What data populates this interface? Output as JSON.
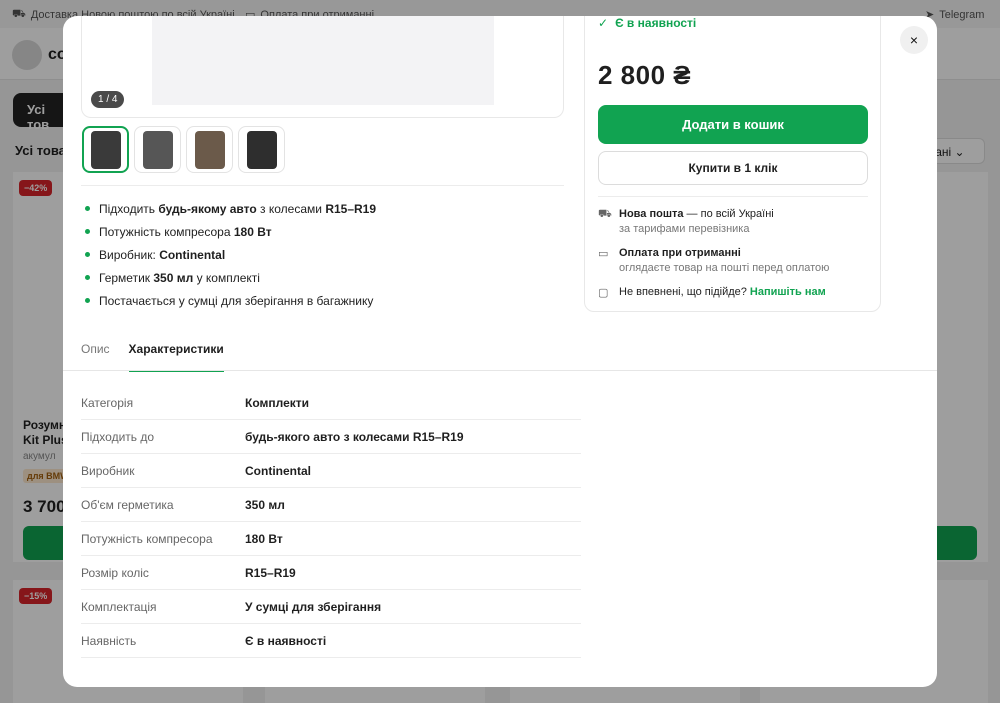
{
  "topbar": {
    "delivery": "Доставка Новою поштою по всій Україні",
    "payment": "Оплата при отриманні",
    "telegram": "Telegram"
  },
  "header": {
    "logo_text": "co"
  },
  "background": {
    "all_button": "Усі тов",
    "section_title": "Усі това",
    "sort": "вані",
    "card1": {
      "discount": "−42%",
      "title_line1": "Розумн",
      "title_line2": "Kit Plus",
      "subtitle": "акумул",
      "tag": "для BMW",
      "price": "3 700"
    },
    "card2": {
      "discount": "−15%"
    }
  },
  "modal": {
    "close_label": "×",
    "gallery": {
      "counter": "1 / 4",
      "thumbnails": [
        "thumb-1",
        "thumb-2",
        "thumb-3",
        "thumb-4"
      ]
    },
    "features": [
      {
        "pre": "Підходить ",
        "bold": "будь-якому авто",
        "mid": " з колесами ",
        "bold2": "R15–R19"
      },
      {
        "pre": "Потужність компресора ",
        "bold": "180 Вт",
        "mid": "",
        "bold2": ""
      },
      {
        "pre": "Виробник: ",
        "bold": "Continental",
        "mid": "",
        "bold2": ""
      },
      {
        "pre": "Герметик ",
        "bold": "350 мл",
        "mid": " у комплекті",
        "bold2": ""
      },
      {
        "pre": "Постачається у сумці для зберігання в багажнику",
        "bold": "",
        "mid": "",
        "bold2": ""
      }
    ],
    "tabs": [
      {
        "label": "Опис",
        "active": false
      },
      {
        "label": "Характеристики",
        "active": true
      }
    ],
    "specs": [
      {
        "key": "Категорія",
        "value": "Комплекти"
      },
      {
        "key": "Підходить до",
        "value": "будь-якого авто з колесами R15–R19"
      },
      {
        "key": "Виробник",
        "value": "Continental"
      },
      {
        "key": "Об'єм герметика",
        "value": "350 мл"
      },
      {
        "key": "Потужність компресора",
        "value": "180 Вт"
      },
      {
        "key": "Розмір коліс",
        "value": "R15–R19"
      },
      {
        "key": "Комплектація",
        "value": "У сумці для зберігання"
      },
      {
        "key": "Наявність",
        "value": "Є в наявності"
      }
    ],
    "buy": {
      "stock": "Є в наявності",
      "price": "2 800 ₴",
      "add_to_cart": "Додати в кошик",
      "buy_one_click": "Купити в 1 клік"
    },
    "info": {
      "delivery_title": "Нова пошта",
      "delivery_rest": " — по всій Україні",
      "delivery_sub": "за тарифами перевізника",
      "payment_title": "Оплата при отриманні",
      "payment_sub": "оглядаєте товар на пошті перед оплатою",
      "help_text": "Не впевнені, що підійде? ",
      "help_link": "Напишіть нам"
    },
    "colors": {
      "accent": "#11a351",
      "discount": "#d9252a"
    }
  }
}
